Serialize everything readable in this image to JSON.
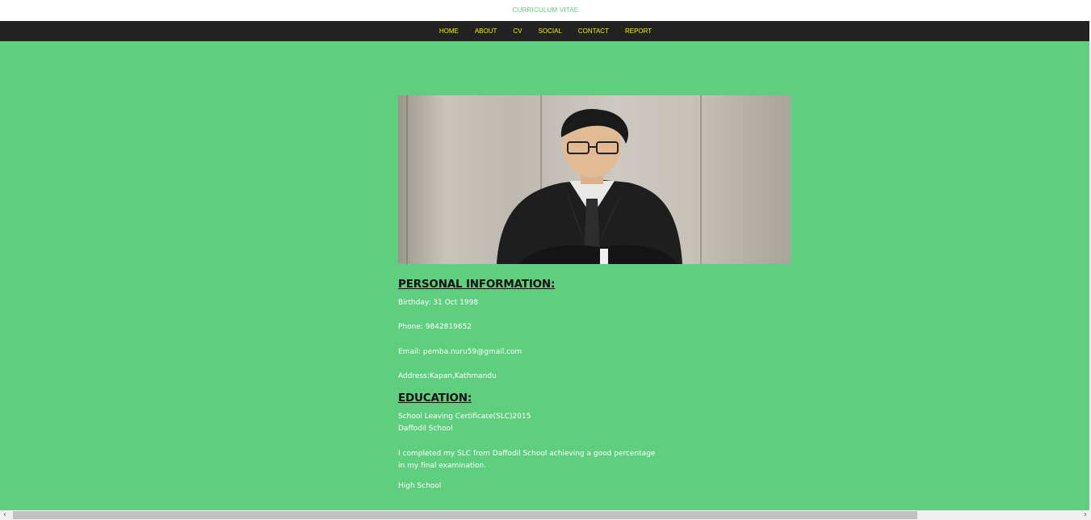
{
  "header": {
    "title": "CURRICULUM VITAE"
  },
  "nav": {
    "items": [
      {
        "label": "HOME"
      },
      {
        "label": "ABOUT"
      },
      {
        "label": "CV"
      },
      {
        "label": "SOCIAL"
      },
      {
        "label": "CONTACT"
      },
      {
        "label": "REPORT"
      }
    ]
  },
  "personal": {
    "heading": "PERSONAL INFORMATION:",
    "birthday": "Birthday: 31 Oct 1998",
    "phone": "Phone: 9842819652",
    "email": "Email: pemba.nuru59@gmail.com",
    "address": "Address:Kapan,Kathmandu"
  },
  "education": {
    "heading": "EDUCATION:",
    "slc_title": "School Leaving Certificate(SLC)2015",
    "slc_school": "Daffodil School",
    "slc_desc_1": "I completed my SLC from Daffodil School achieving a good percentage",
    "slc_desc_2": "in my final examination.",
    "hs_title": "High School"
  },
  "colors": {
    "background": "#5fcf7f",
    "navbar": "#222222",
    "nav_text": "#f0f000"
  }
}
